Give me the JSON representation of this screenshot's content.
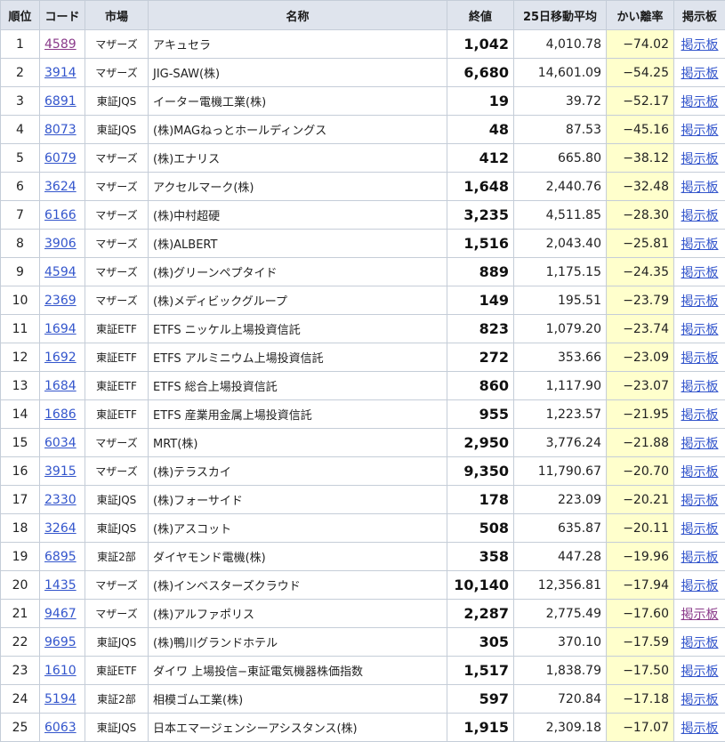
{
  "table": {
    "headers": {
      "rank": "順位",
      "code": "コード",
      "market": "市場",
      "name": "名称",
      "close": "終値",
      "ma25": "25日移動平均",
      "deviation": "かい離率",
      "board": "掲示板"
    },
    "rows": [
      {
        "rank": "1",
        "code": "4589",
        "market": "マザーズ",
        "name": "アキュセラ",
        "close": "1,042",
        "ma25": "4,010.78",
        "deviation": "−74.02",
        "board": "掲示板",
        "code_visited": true,
        "board_visited": false
      },
      {
        "rank": "2",
        "code": "3914",
        "market": "マザーズ",
        "name": "JIG-SAW(株)",
        "close": "6,680",
        "ma25": "14,601.09",
        "deviation": "−54.25",
        "board": "掲示板",
        "code_visited": false,
        "board_visited": false
      },
      {
        "rank": "3",
        "code": "6891",
        "market": "東証JQS",
        "name": "イーター電機工業(株)",
        "close": "19",
        "ma25": "39.72",
        "deviation": "−52.17",
        "board": "掲示板",
        "code_visited": false,
        "board_visited": false
      },
      {
        "rank": "4",
        "code": "8073",
        "market": "東証JQS",
        "name": "(株)MAGねっとホールディングス",
        "close": "48",
        "ma25": "87.53",
        "deviation": "−45.16",
        "board": "掲示板",
        "code_visited": false,
        "board_visited": false
      },
      {
        "rank": "5",
        "code": "6079",
        "market": "マザーズ",
        "name": "(株)エナリス",
        "close": "412",
        "ma25": "665.80",
        "deviation": "−38.12",
        "board": "掲示板",
        "code_visited": false,
        "board_visited": false
      },
      {
        "rank": "6",
        "code": "3624",
        "market": "マザーズ",
        "name": "アクセルマーク(株)",
        "close": "1,648",
        "ma25": "2,440.76",
        "deviation": "−32.48",
        "board": "掲示板",
        "code_visited": false,
        "board_visited": false
      },
      {
        "rank": "7",
        "code": "6166",
        "market": "マザーズ",
        "name": "(株)中村超硬",
        "close": "3,235",
        "ma25": "4,511.85",
        "deviation": "−28.30",
        "board": "掲示板",
        "code_visited": false,
        "board_visited": false
      },
      {
        "rank": "8",
        "code": "3906",
        "market": "マザーズ",
        "name": "(株)ALBERT",
        "close": "1,516",
        "ma25": "2,043.40",
        "deviation": "−25.81",
        "board": "掲示板",
        "code_visited": false,
        "board_visited": false
      },
      {
        "rank": "9",
        "code": "4594",
        "market": "マザーズ",
        "name": "(株)グリーンペプタイド",
        "close": "889",
        "ma25": "1,175.15",
        "deviation": "−24.35",
        "board": "掲示板",
        "code_visited": false,
        "board_visited": false
      },
      {
        "rank": "10",
        "code": "2369",
        "market": "マザーズ",
        "name": "(株)メディビックグループ",
        "close": "149",
        "ma25": "195.51",
        "deviation": "−23.79",
        "board": "掲示板",
        "code_visited": false,
        "board_visited": false
      },
      {
        "rank": "11",
        "code": "1694",
        "market": "東証ETF",
        "name": "ETFS ニッケル上場投資信託",
        "close": "823",
        "ma25": "1,079.20",
        "deviation": "−23.74",
        "board": "掲示板",
        "code_visited": false,
        "board_visited": false
      },
      {
        "rank": "12",
        "code": "1692",
        "market": "東証ETF",
        "name": "ETFS アルミニウム上場投資信託",
        "close": "272",
        "ma25": "353.66",
        "deviation": "−23.09",
        "board": "掲示板",
        "code_visited": false,
        "board_visited": false
      },
      {
        "rank": "13",
        "code": "1684",
        "market": "東証ETF",
        "name": "ETFS 総合上場投資信託",
        "close": "860",
        "ma25": "1,117.90",
        "deviation": "−23.07",
        "board": "掲示板",
        "code_visited": false,
        "board_visited": false
      },
      {
        "rank": "14",
        "code": "1686",
        "market": "東証ETF",
        "name": "ETFS 産業用金属上場投資信託",
        "close": "955",
        "ma25": "1,223.57",
        "deviation": "−21.95",
        "board": "掲示板",
        "code_visited": false,
        "board_visited": false
      },
      {
        "rank": "15",
        "code": "6034",
        "market": "マザーズ",
        "name": "MRT(株)",
        "close": "2,950",
        "ma25": "3,776.24",
        "deviation": "−21.88",
        "board": "掲示板",
        "code_visited": false,
        "board_visited": false
      },
      {
        "rank": "16",
        "code": "3915",
        "market": "マザーズ",
        "name": "(株)テラスカイ",
        "close": "9,350",
        "ma25": "11,790.67",
        "deviation": "−20.70",
        "board": "掲示板",
        "code_visited": false,
        "board_visited": false
      },
      {
        "rank": "17",
        "code": "2330",
        "market": "東証JQS",
        "name": "(株)フォーサイド",
        "close": "178",
        "ma25": "223.09",
        "deviation": "−20.21",
        "board": "掲示板",
        "code_visited": false,
        "board_visited": false
      },
      {
        "rank": "18",
        "code": "3264",
        "market": "東証JQS",
        "name": "(株)アスコット",
        "close": "508",
        "ma25": "635.87",
        "deviation": "−20.11",
        "board": "掲示板",
        "code_visited": false,
        "board_visited": false
      },
      {
        "rank": "19",
        "code": "6895",
        "market": "東証2部",
        "name": "ダイヤモンド電機(株)",
        "close": "358",
        "ma25": "447.28",
        "deviation": "−19.96",
        "board": "掲示板",
        "code_visited": false,
        "board_visited": false
      },
      {
        "rank": "20",
        "code": "1435",
        "market": "マザーズ",
        "name": "(株)インベスターズクラウド",
        "close": "10,140",
        "ma25": "12,356.81",
        "deviation": "−17.94",
        "board": "掲示板",
        "code_visited": false,
        "board_visited": false
      },
      {
        "rank": "21",
        "code": "9467",
        "market": "マザーズ",
        "name": "(株)アルファポリス",
        "close": "2,287",
        "ma25": "2,775.49",
        "deviation": "−17.60",
        "board": "掲示板",
        "code_visited": false,
        "board_visited": true
      },
      {
        "rank": "22",
        "code": "9695",
        "market": "東証JQS",
        "name": "(株)鴨川グランドホテル",
        "close": "305",
        "ma25": "370.10",
        "deviation": "−17.59",
        "board": "掲示板",
        "code_visited": false,
        "board_visited": false
      },
      {
        "rank": "23",
        "code": "1610",
        "market": "東証ETF",
        "name": "ダイワ 上場投信−東証電気機器株価指数",
        "close": "1,517",
        "ma25": "1,838.79",
        "deviation": "−17.50",
        "board": "掲示板",
        "code_visited": false,
        "board_visited": false
      },
      {
        "rank": "24",
        "code": "5194",
        "market": "東証2部",
        "name": "相模ゴム工業(株)",
        "close": "597",
        "ma25": "720.84",
        "deviation": "−17.18",
        "board": "掲示板",
        "code_visited": false,
        "board_visited": false
      },
      {
        "rank": "25",
        "code": "6063",
        "market": "東証JQS",
        "name": "日本エマージェンシーアシスタンス(株)",
        "close": "1,915",
        "ma25": "2,309.18",
        "deviation": "−17.07",
        "board": "掲示板",
        "code_visited": false,
        "board_visited": false
      }
    ]
  },
  "colors": {
    "header_bg": "#dfe4ed",
    "border": "#c5cdd8",
    "link": "#3355cc",
    "visited_link": "#8a3a8a",
    "deviation_bg": "#ffffcc"
  }
}
